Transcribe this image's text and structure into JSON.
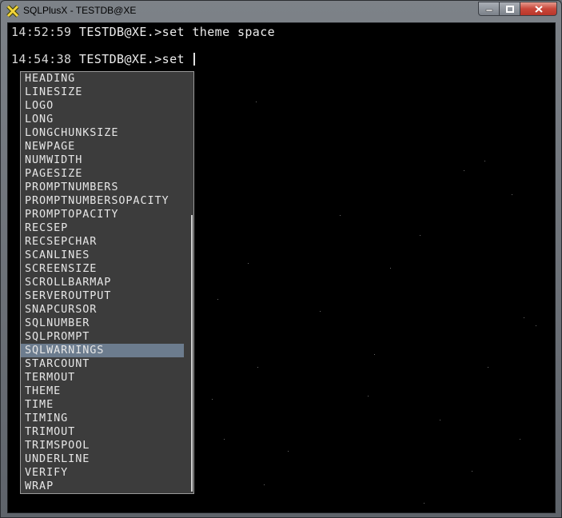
{
  "window": {
    "title": "SQLPlusX - TESTDB@XE",
    "controls": {
      "minimize_icon": "minimize-icon",
      "maximize_icon": "maximize-icon",
      "close_icon": "close-icon"
    }
  },
  "console": {
    "lines": [
      {
        "time": "14:52:59",
        "prompt": "TESTDB@XE.>",
        "command": "set theme space"
      },
      {
        "time": "14:54:38",
        "prompt": "TESTDB@XE.>",
        "command": "set "
      }
    ]
  },
  "autocomplete": {
    "selected": "SQLWARNINGS",
    "items": [
      "HEADING",
      "LINESIZE",
      "LOGO",
      "LONG",
      "LONGCHUNKSIZE",
      "NEWPAGE",
      "NUMWIDTH",
      "PAGESIZE",
      "PROMPTNUMBERS",
      "PROMPTNUMBERSOPACITY",
      "PROMPTOPACITY",
      "RECSEP",
      "RECSEPCHAR",
      "SCANLINES",
      "SCREENSIZE",
      "SCROLLBARMAP",
      "SERVEROUTPUT",
      "SNAPCURSOR",
      "SQLNUMBER",
      "SQLPROMPT",
      "SQLWARNINGS",
      "STARCOUNT",
      "TERMOUT",
      "THEME",
      "TIME",
      "TIMING",
      "TRIMOUT",
      "TRIMSPOOL",
      "UNDERLINE",
      "VERIFY",
      "WRAP"
    ],
    "selection_bg": "#6c7c8e"
  }
}
